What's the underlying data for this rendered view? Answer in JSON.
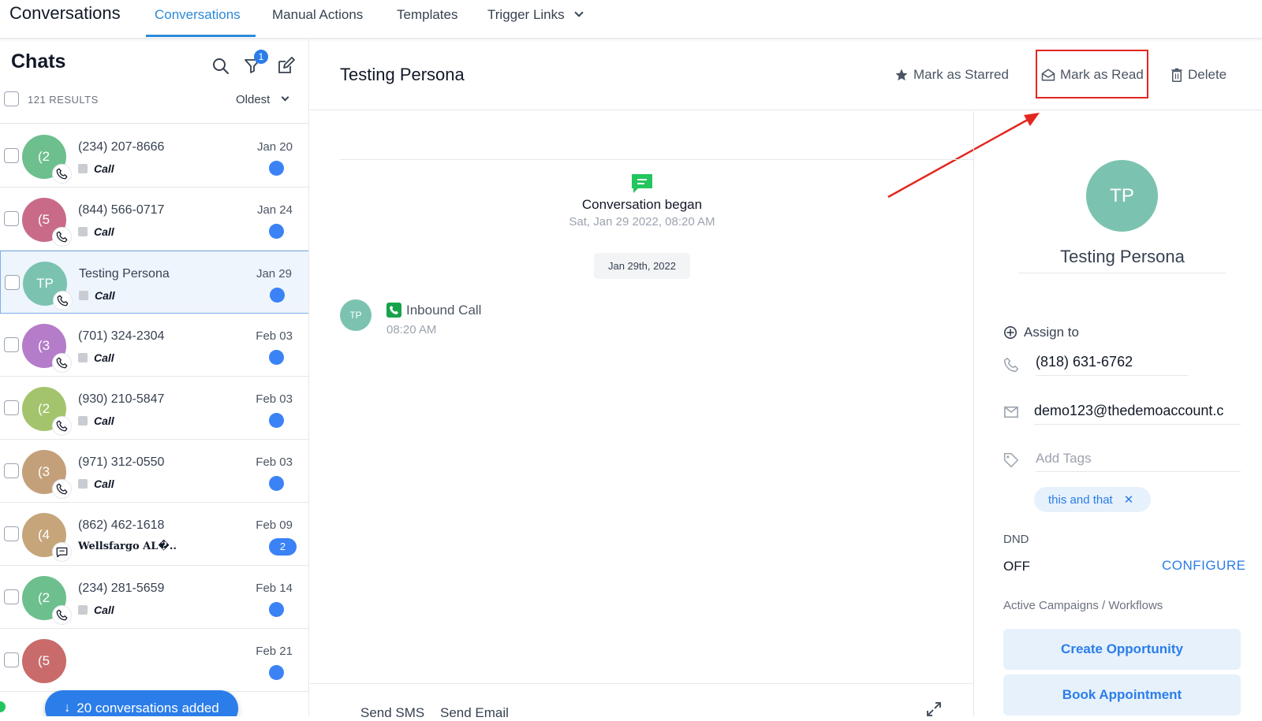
{
  "nav": {
    "app_title": "Conversations",
    "tabs": [
      "Conversations",
      "Manual Actions",
      "Templates",
      "Trigger Links"
    ]
  },
  "chats": {
    "title": "Chats",
    "filter_badge": "1",
    "results": "121 RESULTS",
    "sort": "Oldest",
    "rows": [
      {
        "name": "(234) 207-8666",
        "avatar": "(2",
        "avatar_color": "#6dbf8e",
        "preview": "Call",
        "date": "Jan 20",
        "channel": "phone-icon"
      },
      {
        "name": "(844) 566-0717",
        "avatar": "(5",
        "avatar_color": "#c96b88",
        "preview": "Call",
        "date": "Jan 24",
        "channel": "phone-icon"
      },
      {
        "name": "Testing Persona",
        "avatar": "TP",
        "avatar_color": "#7bc3b0",
        "preview": "Call",
        "date": "Jan 29",
        "channel": "phone-icon"
      },
      {
        "name": "(701) 324-2304",
        "avatar": "(3",
        "avatar_color": "#b57cc9",
        "preview": "Call",
        "date": "Feb 03",
        "channel": "phone-icon"
      },
      {
        "name": "(930) 210-5847",
        "avatar": "(2",
        "avatar_color": "#a3c46c",
        "preview": "Call",
        "date": "Feb 03",
        "channel": "phone-icon"
      },
      {
        "name": "(971) 312-0550",
        "avatar": "(3",
        "avatar_color": "#c4a07a",
        "preview": "Call",
        "date": "Feb 03",
        "channel": "phone-icon"
      },
      {
        "name": "(862) 462-1618",
        "avatar": "(4",
        "avatar_color": "#c6a57a",
        "preview": "Wellsfargo AL�..",
        "date": "Feb 09",
        "channel": "sms-icon",
        "count": "2"
      },
      {
        "name": "(234) 281-5659",
        "avatar": "(2",
        "avatar_color": "#6dbf8e",
        "preview": "Call",
        "date": "Feb 14",
        "channel": "phone-icon"
      },
      {
        "name": "",
        "avatar": "(5",
        "avatar_color": "#c96b6b",
        "preview": "",
        "date": "Feb 21",
        "channel": ""
      }
    ],
    "toast": "20 conversations added"
  },
  "conversation": {
    "title": "Testing Persona",
    "actions": {
      "star": "Mark as Starred",
      "read": "Mark as Read",
      "delete": "Delete"
    },
    "began_title": "Conversation began",
    "began_date": "Sat, Jan 29 2022, 08:20 AM",
    "date_chip": "Jan 29th, 2022",
    "message": {
      "avatar": "TP",
      "title": "Inbound Call",
      "time": "08:20 AM"
    },
    "composer_tabs": [
      "Send SMS",
      "Send Email"
    ]
  },
  "contact": {
    "avatar": "TP",
    "name": "Testing Persona",
    "assign": "Assign to",
    "phone": "(818) 631-6762",
    "email": "demo123@thedemoaccount.c",
    "tags_placeholder": "Add Tags",
    "tag": "this and that",
    "dnd_label": "DND",
    "dnd_value": "OFF",
    "configure": "CONFIGURE",
    "campaigns_label": "Active Campaigns / Workflows",
    "buttons": [
      "Create Opportunity",
      "Book Appointment"
    ]
  },
  "colors": {
    "accent": "#2b8ad8",
    "highlight": "#e3261f",
    "call_green": "#16a34a"
  }
}
